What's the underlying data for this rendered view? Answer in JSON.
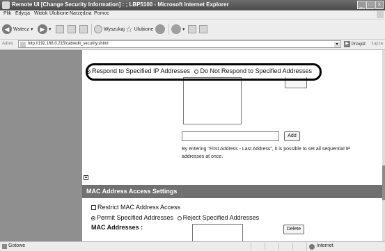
{
  "window": {
    "title": "Remote UI [Change Security Information] : ; LBP5100 - Microsoft Internet Explorer",
    "controls": {
      "minimize": "_",
      "maximize": "□",
      "close": "×"
    }
  },
  "menu": {
    "items": [
      "Plik",
      "Edycja",
      "Widok",
      "Ulubione",
      "Narzędzia",
      "Pomoc"
    ]
  },
  "toolbar": {
    "back_label": "Wstecz",
    "search_label": "Wyszukaj",
    "favorites_label": "Ulubione"
  },
  "address": {
    "label": "Adres",
    "url": "http://192.168.0.215/cab/edit_security.shtml",
    "go_label": "Przejdź",
    "links_label": "Łącza"
  },
  "ip_section": {
    "option_respond": "Respond to Specified IP Addresses",
    "option_not_respond": "Do Not Respond to Specified Addresses",
    "add_button": "Add",
    "help_text": "By entering \"First Address - Last Address\", it is possible to set all sequential IP addresses at once."
  },
  "mac_section": {
    "header": "MAC Address Access Settings",
    "restrict_label": "Restrict MAC Address Access",
    "option_permit": "Permit Specified Addresses",
    "option_reject": "Reject Specified Addresses",
    "addresses_label": "MAC Addresses :",
    "delete_button": "Delete"
  },
  "status": {
    "text": "Gotowe",
    "zone": "Internet"
  }
}
